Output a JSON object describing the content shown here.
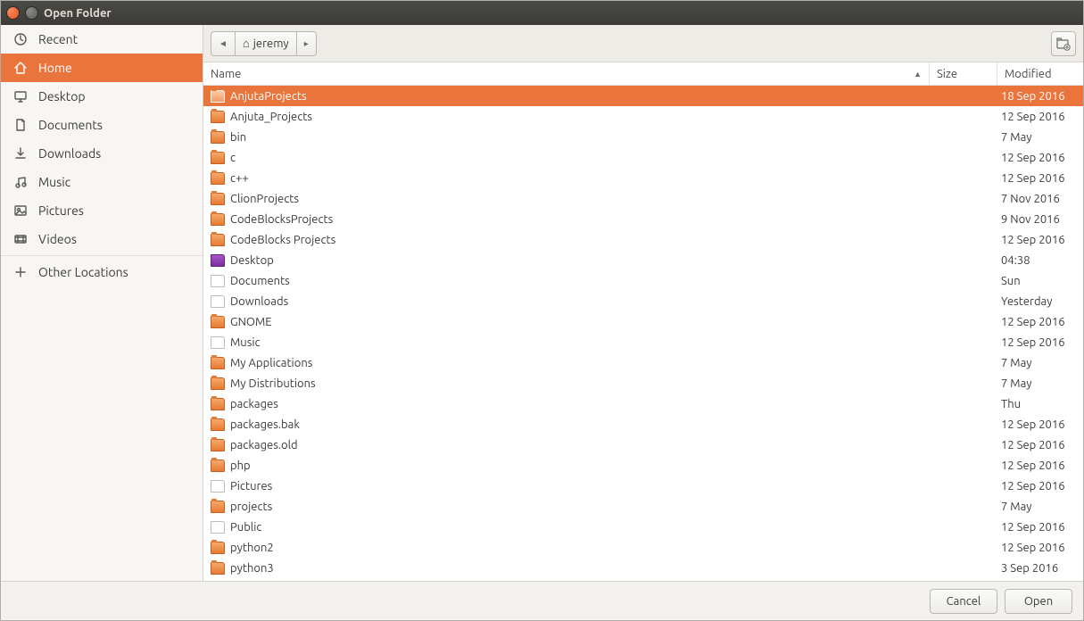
{
  "window": {
    "title": "Open Folder"
  },
  "sidebar": {
    "places": [
      {
        "label": "Recent",
        "icon": "clock"
      },
      {
        "label": "Home",
        "icon": "home",
        "active": true
      },
      {
        "label": "Desktop",
        "icon": "desktop"
      },
      {
        "label": "Documents",
        "icon": "document"
      },
      {
        "label": "Downloads",
        "icon": "download"
      },
      {
        "label": "Music",
        "icon": "music"
      },
      {
        "label": "Pictures",
        "icon": "pictures"
      },
      {
        "label": "Videos",
        "icon": "videos"
      }
    ],
    "other": {
      "label": "Other Locations",
      "icon": "plus"
    }
  },
  "path": {
    "back_icon": "◄",
    "current_icon": "⌂",
    "current": "jeremy",
    "forward_icon": "▸"
  },
  "headers": {
    "name": "Name",
    "size": "Size",
    "modified": "Modified",
    "sort": "▲"
  },
  "files": [
    {
      "name": "AnjutaProjects",
      "icon": "folder",
      "size": "",
      "modified": "18 Sep 2016",
      "selected": true
    },
    {
      "name": "Anjuta_Projects",
      "icon": "folder",
      "size": "",
      "modified": "12 Sep 2016"
    },
    {
      "name": "bin",
      "icon": "folder",
      "size": "",
      "modified": "7 May"
    },
    {
      "name": "c",
      "icon": "folder",
      "size": "",
      "modified": "12 Sep 2016"
    },
    {
      "name": "c++",
      "icon": "folder",
      "size": "",
      "modified": "12 Sep 2016"
    },
    {
      "name": "ClionProjects",
      "icon": "folder",
      "size": "",
      "modified": "7 Nov 2016"
    },
    {
      "name": "CodeBlocksProjects",
      "icon": "folder",
      "size": "",
      "modified": "9 Nov 2016"
    },
    {
      "name": "CodeBlocks Projects",
      "icon": "folder",
      "size": "",
      "modified": "12 Sep 2016"
    },
    {
      "name": "Desktop",
      "icon": "desk",
      "size": "",
      "modified": "04:38"
    },
    {
      "name": "Documents",
      "icon": "docs",
      "size": "",
      "modified": "Sun"
    },
    {
      "name": "Downloads",
      "icon": "docs",
      "size": "",
      "modified": "Yesterday"
    },
    {
      "name": "GNOME",
      "icon": "folder",
      "size": "",
      "modified": "12 Sep 2016"
    },
    {
      "name": "Music",
      "icon": "docs",
      "size": "",
      "modified": "12 Sep 2016"
    },
    {
      "name": "My Applications",
      "icon": "folder",
      "size": "",
      "modified": "7 May"
    },
    {
      "name": "My Distributions",
      "icon": "folder",
      "size": "",
      "modified": "7 May"
    },
    {
      "name": "packages",
      "icon": "folder",
      "size": "",
      "modified": "Thu"
    },
    {
      "name": "packages.bak",
      "icon": "folder",
      "size": "",
      "modified": "12 Sep 2016"
    },
    {
      "name": "packages.old",
      "icon": "folder",
      "size": "",
      "modified": "12 Sep 2016"
    },
    {
      "name": "php",
      "icon": "folder",
      "size": "",
      "modified": "12 Sep 2016"
    },
    {
      "name": "Pictures",
      "icon": "docs",
      "size": "",
      "modified": "12 Sep 2016"
    },
    {
      "name": "projects",
      "icon": "folder",
      "size": "",
      "modified": "7 May"
    },
    {
      "name": "Public",
      "icon": "docs",
      "size": "",
      "modified": "12 Sep 2016"
    },
    {
      "name": "python2",
      "icon": "folder",
      "size": "",
      "modified": "12 Sep 2016"
    },
    {
      "name": "python3",
      "icon": "folder",
      "size": "",
      "modified": "3 Sep 2016"
    }
  ],
  "footer": {
    "cancel": "Cancel",
    "open": "Open"
  }
}
